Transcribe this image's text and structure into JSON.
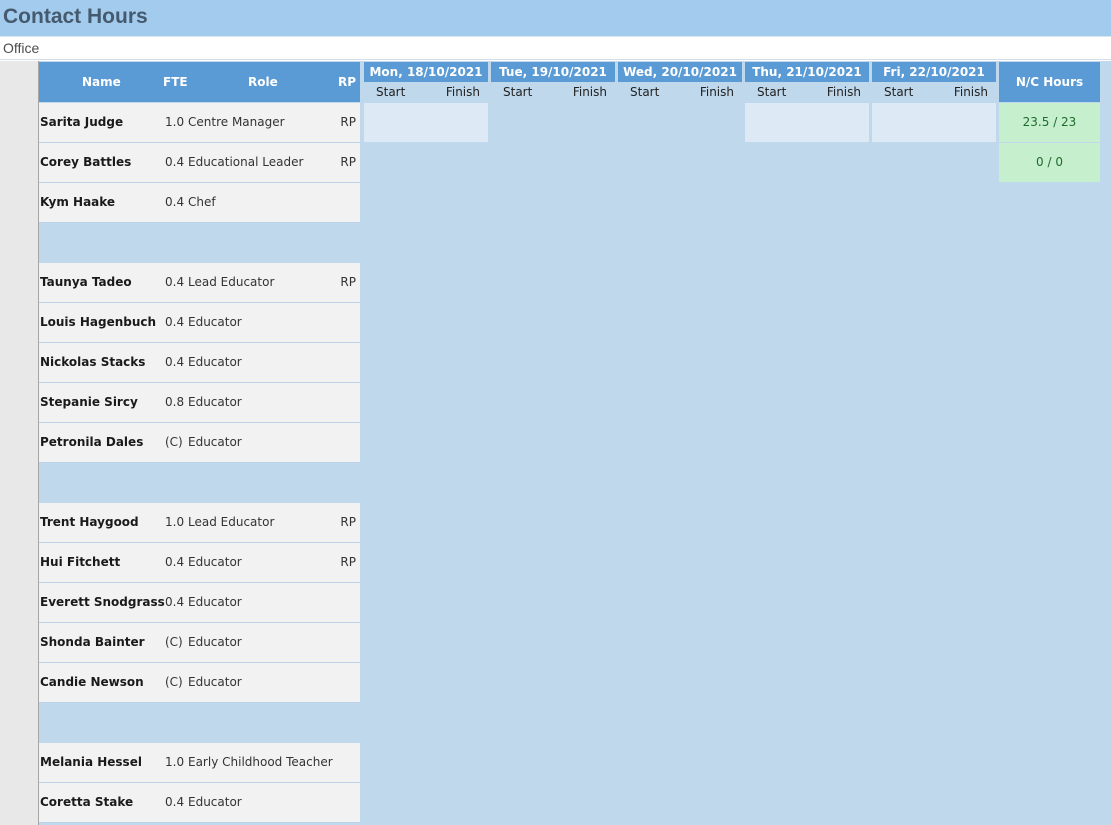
{
  "header": {
    "title": "Contact Hours",
    "subtitle": "Office"
  },
  "columns": {
    "name": "Name",
    "fte": "FTE",
    "role": "Role",
    "rp": "RP",
    "nc_hours": "N/C Hours",
    "start": "Start",
    "finish": "Finish"
  },
  "days": [
    {
      "label": "Mon, 18/10/2021"
    },
    {
      "label": "Tue, 19/10/2021"
    },
    {
      "label": "Wed, 20/10/2021"
    },
    {
      "label": "Thu, 21/10/2021"
    },
    {
      "label": "Fri, 22/10/2021"
    }
  ],
  "staff": [
    {
      "name": "Sarita Judge",
      "fte": "1.0",
      "role": "Centre Manager",
      "rp": "RP",
      "nc_hours": "23.5 / 23"
    },
    {
      "name": "Corey Battles",
      "fte": "0.4",
      "role": "Educational Leader",
      "rp": "RP",
      "nc_hours": "0 / 0"
    },
    {
      "name": "Kym Haake",
      "fte": "0.4",
      "role": "Chef",
      "rp": ""
    },
    {
      "name": "Taunya Tadeo",
      "fte": "0.4",
      "role": "Lead Educator",
      "rp": "RP"
    },
    {
      "name": "Louis Hagenbuch",
      "fte": "0.4",
      "role": "Educator",
      "rp": ""
    },
    {
      "name": "Nickolas Stacks",
      "fte": "0.4",
      "role": "Educator",
      "rp": ""
    },
    {
      "name": "Stepanie Sircy",
      "fte": "0.8",
      "role": "Educator",
      "rp": ""
    },
    {
      "name": "Petronila Dales",
      "fte": "(C)",
      "role": "Educator",
      "rp": ""
    },
    {
      "name": "Trent Haygood",
      "fte": "1.0",
      "role": "Lead Educator",
      "rp": "RP"
    },
    {
      "name": "Hui Fitchett",
      "fte": "0.4",
      "role": "Educator",
      "rp": "RP"
    },
    {
      "name": "Everett Snodgrass",
      "fte": "0.4",
      "role": "Educator",
      "rp": ""
    },
    {
      "name": "Shonda Bainter",
      "fte": "(C)",
      "role": "Educator",
      "rp": ""
    },
    {
      "name": "Candie Newson",
      "fte": "(C)",
      "role": "Educator",
      "rp": ""
    },
    {
      "name": "Melania Hessel",
      "fte": "1.0",
      "role": "Early Childhood Teacher",
      "rp": ""
    },
    {
      "name": "Coretta Stake",
      "fte": "0.4",
      "role": "Educator",
      "rp": ""
    }
  ]
}
